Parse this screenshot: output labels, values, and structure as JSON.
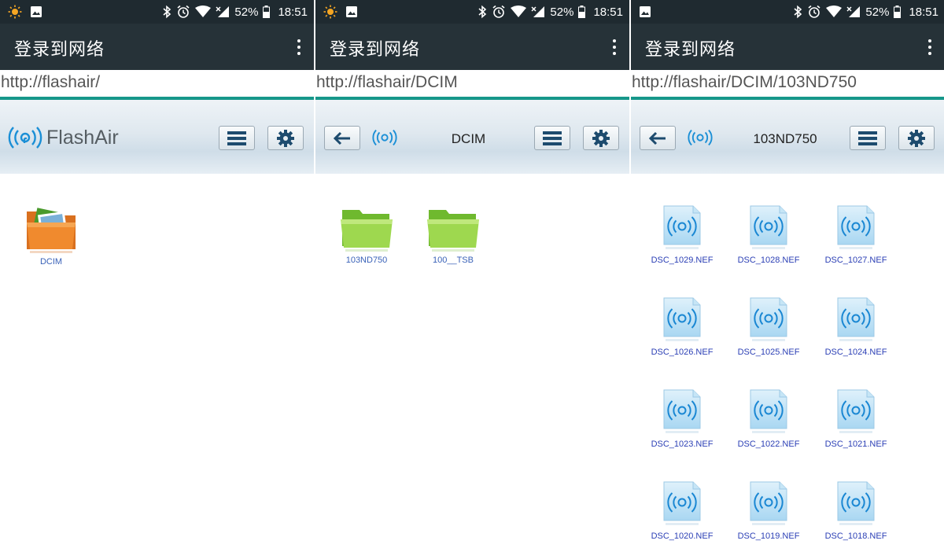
{
  "status_bar": {
    "battery": "52%",
    "time": "18:51"
  },
  "screens": [
    {
      "app_title": "登录到网络",
      "url": "http://flashair/",
      "header_logo": "FlashAir",
      "items": [
        {
          "label": "DCIM",
          "icon": "photo-folder-icon"
        }
      ]
    },
    {
      "app_title": "登录到网络",
      "url": "http://flashair/DCIM",
      "folder_title": "DCIM",
      "items": [
        {
          "label": "103ND750",
          "icon": "green-folder-icon"
        },
        {
          "label": "100__TSB",
          "icon": "green-folder-icon"
        }
      ]
    },
    {
      "app_title": "登录到网络",
      "url": "http://flashair/DCIM/103ND750",
      "folder_title": "103ND750",
      "items": [
        {
          "label": "DSC_1029.NEF",
          "icon": "nef-file-icon"
        },
        {
          "label": "DSC_1028.NEF",
          "icon": "nef-file-icon"
        },
        {
          "label": "DSC_1027.NEF",
          "icon": "nef-file-icon"
        },
        {
          "label": "DSC_1026.NEF",
          "icon": "nef-file-icon"
        },
        {
          "label": "DSC_1025.NEF",
          "icon": "nef-file-icon"
        },
        {
          "label": "DSC_1024.NEF",
          "icon": "nef-file-icon"
        },
        {
          "label": "DSC_1023.NEF",
          "icon": "nef-file-icon"
        },
        {
          "label": "DSC_1022.NEF",
          "icon": "nef-file-icon"
        },
        {
          "label": "DSC_1021.NEF",
          "icon": "nef-file-icon"
        },
        {
          "label": "DSC_1020.NEF",
          "icon": "nef-file-icon"
        },
        {
          "label": "DSC_1019.NEF",
          "icon": "nef-file-icon"
        },
        {
          "label": "DSC_1018.NEF",
          "icon": "nef-file-icon"
        }
      ]
    }
  ],
  "colors": {
    "status_bar": "#1f2a30",
    "app_bar": "#263238",
    "url_underline": "#16978a",
    "file_label": "#2b3fb5",
    "folder_label": "#3a62b8"
  }
}
